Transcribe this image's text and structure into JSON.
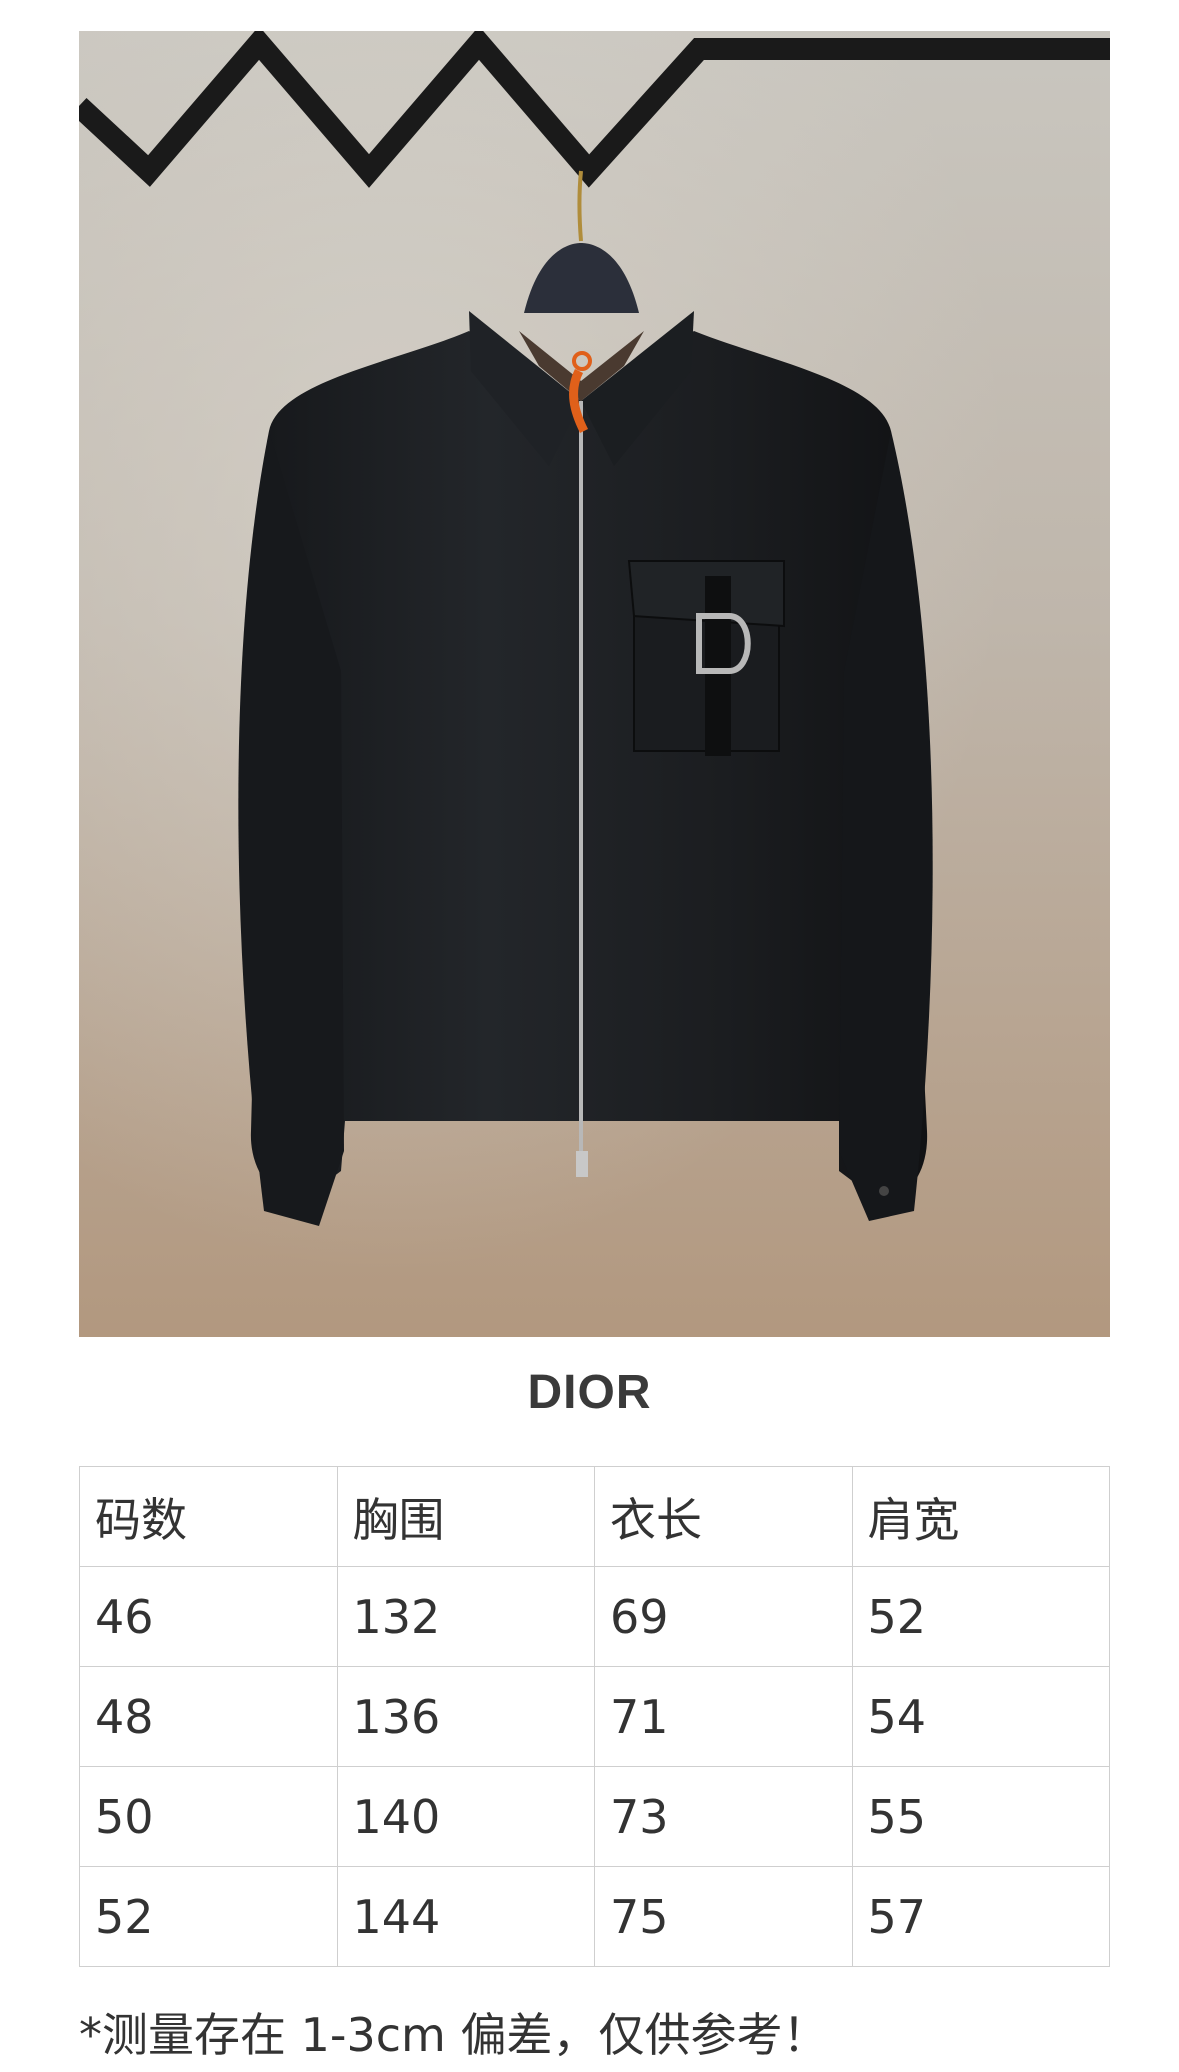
{
  "product_photo": {
    "description_icon": "jacket-photo",
    "colors": {
      "background_top": "#c9c5bd",
      "background_bottom": "#b89e86",
      "jacket": "#1d1f22",
      "zip_pull": "#e0601a"
    }
  },
  "brand": "DIOR",
  "size_table": {
    "headers": [
      "码数",
      "胸围",
      "衣长",
      "肩宽"
    ],
    "rows": [
      [
        "46",
        "132",
        "69",
        "52"
      ],
      [
        "48",
        "136",
        "71",
        "54"
      ],
      [
        "50",
        "140",
        "73",
        "55"
      ],
      [
        "52",
        "144",
        "75",
        "57"
      ]
    ]
  },
  "note": "*测量存在 1-3cm 偏差，仅供参考！"
}
